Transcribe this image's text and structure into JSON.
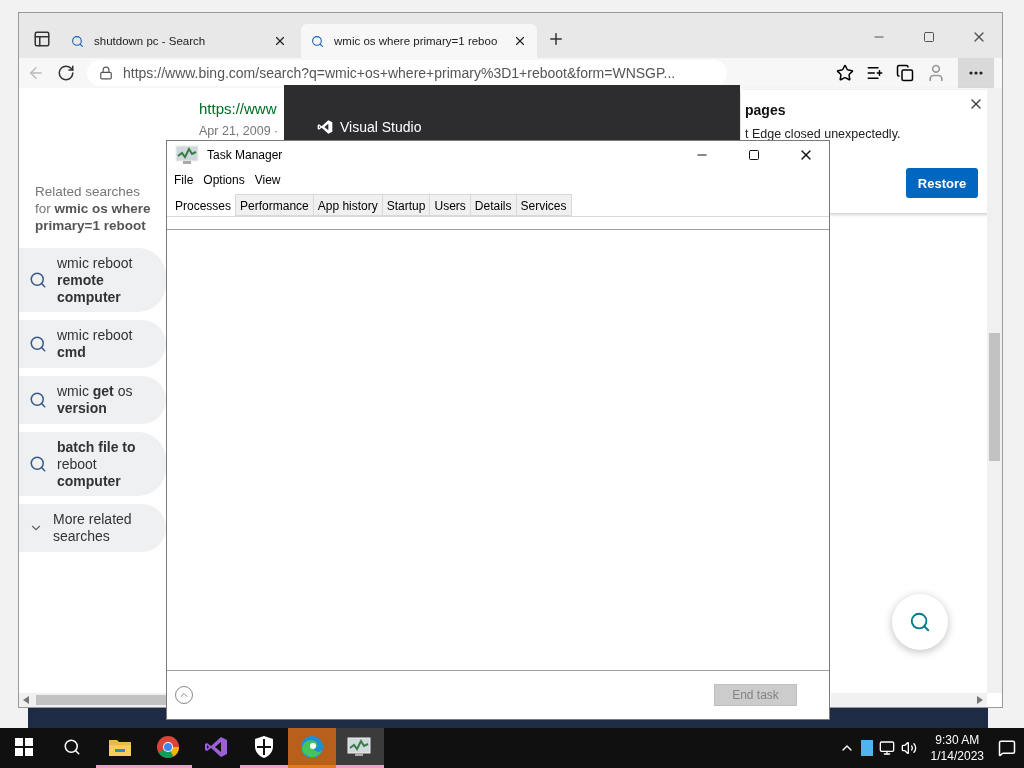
{
  "browser": {
    "tabs": [
      {
        "title": "shutdown pc - Search",
        "selected": false
      },
      {
        "title": "wmic os where primary=1 reboo",
        "selected": true
      }
    ],
    "address": "https://www.bing.com/search?q=wmic+os+where+primary%3D1+reboot&form=WNSGP...",
    "result": {
      "url": "https://www",
      "date": "Apr 21, 2009 ·"
    },
    "related": {
      "heading": "Related searches for **wmic os where primary=1 reboot**",
      "items": [
        {
          "kind": "search",
          "text": "wmic reboot **remote computer**"
        },
        {
          "kind": "search",
          "text": "wmic reboot **cmd**"
        },
        {
          "kind": "search",
          "text": "wmic **get** os **version**"
        },
        {
          "kind": "search",
          "text": "**batch file to** reboot **computer**"
        },
        {
          "kind": "more",
          "text": "More related searches"
        }
      ]
    },
    "restore_prompt": {
      "title": "pages",
      "message": "t Edge closed unexpectedly.",
      "button": "Restore"
    }
  },
  "splash": {
    "title": "Visual Studio"
  },
  "task_manager": {
    "title": "Task Manager",
    "menu": [
      "File",
      "Options",
      "View"
    ],
    "tabs": [
      {
        "label": "Processes",
        "selected": true
      },
      {
        "label": "Performance",
        "selected": false
      },
      {
        "label": "App history",
        "selected": false
      },
      {
        "label": "Startup",
        "selected": false
      },
      {
        "label": "Users",
        "selected": false
      },
      {
        "label": "Details",
        "selected": false
      },
      {
        "label": "Services",
        "selected": false
      }
    ],
    "end_task": {
      "label": "End task",
      "disabled": true
    }
  },
  "taskbar": {
    "apps": [
      {
        "kind": "explorer",
        "running": true,
        "selected": false,
        "flashing": false
      },
      {
        "kind": "chrome",
        "running": true,
        "selected": false,
        "flashing": false
      },
      {
        "kind": "visualstudio",
        "running": false,
        "selected": false,
        "flashing": false
      },
      {
        "kind": "security",
        "running": true,
        "selected": false,
        "flashing": false
      },
      {
        "kind": "edge",
        "running": true,
        "selected": false,
        "flashing": true
      },
      {
        "kind": "taskmanager",
        "running": true,
        "selected": true,
        "flashing": false
      }
    ],
    "clock": {
      "time": "9:30 AM",
      "date": "1/14/2023"
    }
  }
}
